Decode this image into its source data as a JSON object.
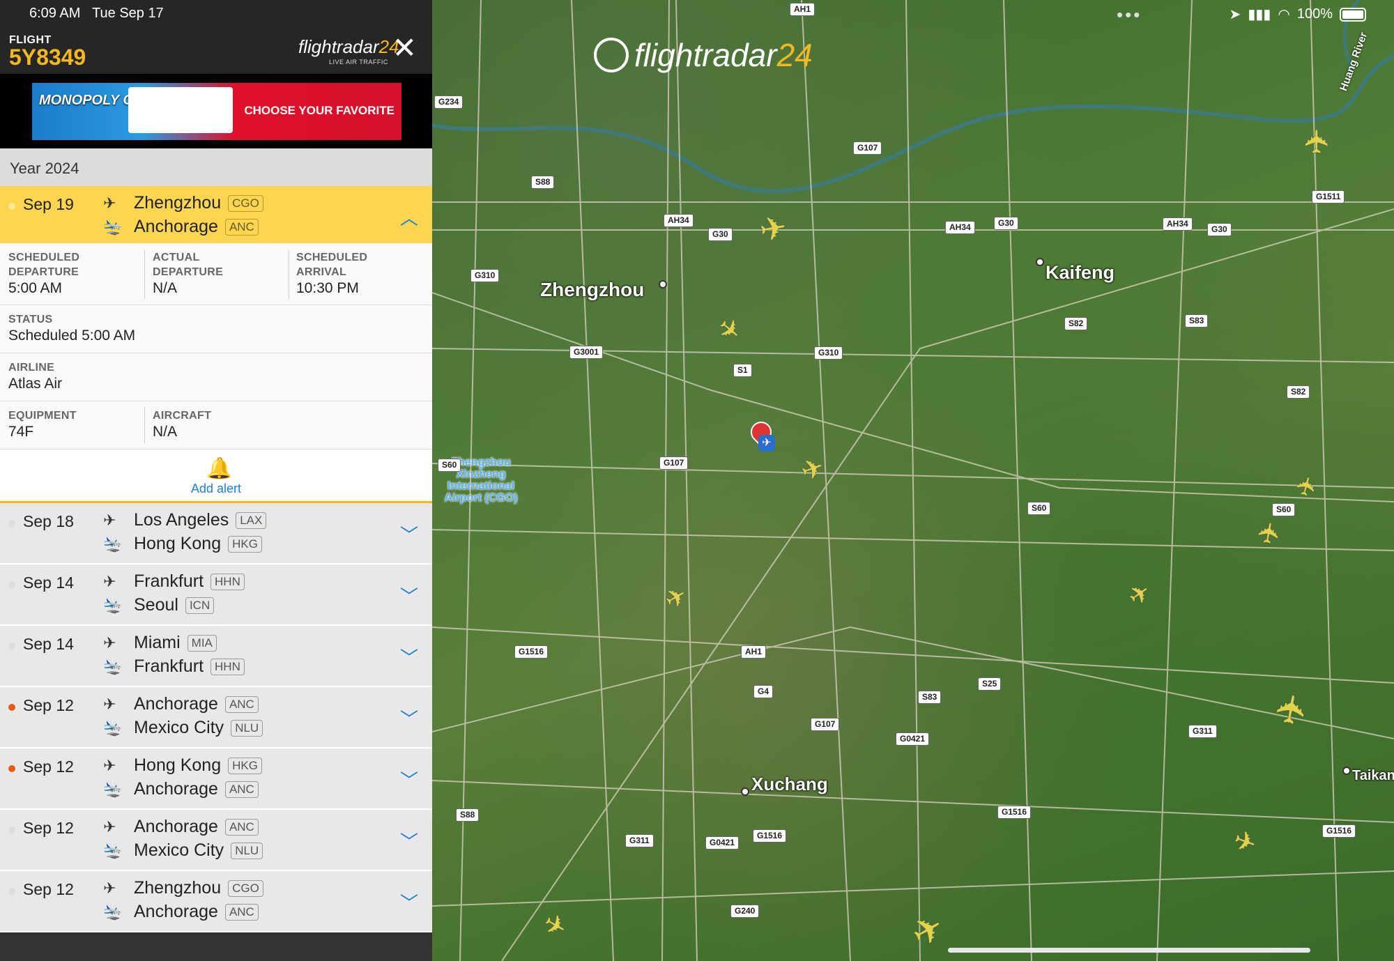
{
  "status_bar": {
    "time": "6:09 AM",
    "date": "Tue Sep 17",
    "battery": "100%"
  },
  "header": {
    "label": "FLIGHT",
    "flight_number": "5Y8349",
    "logo_main": "flightradar",
    "logo_num": "24",
    "logo_sub": "LIVE AIR TRAFFIC",
    "close_icon": "close-icon"
  },
  "ad": {
    "brand": "MONOPOLY GO!",
    "cta": "CHOOSE YOUR FAVORITE"
  },
  "year_label": "Year 2024",
  "flights": [
    {
      "date": "Sep 19",
      "from_city": "Zhengzhou",
      "from_code": "CGO",
      "to_city": "Anchorage",
      "to_code": "ANC",
      "dot": "grey",
      "expanded": true
    },
    {
      "date": "Sep 18",
      "from_city": "Los Angeles",
      "from_code": "LAX",
      "to_city": "Hong Kong",
      "to_code": "HKG",
      "dot": "grey"
    },
    {
      "date": "Sep 14",
      "from_city": "Frankfurt",
      "from_code": "HHN",
      "to_city": "Seoul",
      "to_code": "ICN",
      "dot": "grey"
    },
    {
      "date": "Sep 14",
      "from_city": "Miami",
      "from_code": "MIA",
      "to_city": "Frankfurt",
      "to_code": "HHN",
      "dot": "grey"
    },
    {
      "date": "Sep 12",
      "from_city": "Anchorage",
      "from_code": "ANC",
      "to_city": "Mexico City",
      "to_code": "NLU",
      "dot": "orange"
    },
    {
      "date": "Sep 12",
      "from_city": "Hong Kong",
      "from_code": "HKG",
      "to_city": "Anchorage",
      "to_code": "ANC",
      "dot": "orange"
    },
    {
      "date": "Sep 12",
      "from_city": "Anchorage",
      "from_code": "ANC",
      "to_city": "Mexico City",
      "to_code": "NLU",
      "dot": "grey"
    },
    {
      "date": "Sep 12",
      "from_city": "Zhengzhou",
      "from_code": "CGO",
      "to_city": "Anchorage",
      "to_code": "ANC",
      "dot": "grey"
    }
  ],
  "details": {
    "sched_dep_label": "SCHEDULED DEPARTURE",
    "sched_dep": "5:00 AM",
    "actual_dep_label": "ACTUAL DEPARTURE",
    "actual_dep": "N/A",
    "sched_arr_label": "SCHEDULED ARRIVAL",
    "sched_arr": "10:30 PM",
    "status_label": "STATUS",
    "status": "Scheduled 5:00 AM",
    "airline_label": "AIRLINE",
    "airline": "Atlas Air",
    "equipment_label": "EQUIPMENT",
    "equipment": "74F",
    "aircraft_label": "AIRCRAFT",
    "aircraft": "N/A",
    "add_alert": "Add alert"
  },
  "map": {
    "logo_main": "flightradar",
    "logo_num": "24",
    "cities": [
      "Zhengzhou",
      "Kaifeng",
      "Xuchang",
      "Taikang"
    ],
    "airport": "Zhengzhou Xinzheng International Airport (CGO)",
    "river": "Huang River",
    "routes": [
      "AH1",
      "G234",
      "G107",
      "G1511",
      "S88",
      "AH34",
      "G30",
      "AH34",
      "G30",
      "AH34",
      "G30",
      "G310",
      "S82",
      "S83",
      "G3001",
      "S1",
      "G310",
      "S82",
      "S60",
      "G107",
      "S60",
      "S60",
      "G1516",
      "AH1",
      "S25",
      "G4",
      "S83",
      "G107",
      "G0421",
      "G311",
      "S88",
      "G1516",
      "G311",
      "G0421",
      "G1516",
      "G1516",
      "G240"
    ]
  },
  "colors": {
    "accent": "#f5b820",
    "selected_row": "#fcd551",
    "link": "#1e7fd6",
    "plane": "#e3d34a"
  }
}
